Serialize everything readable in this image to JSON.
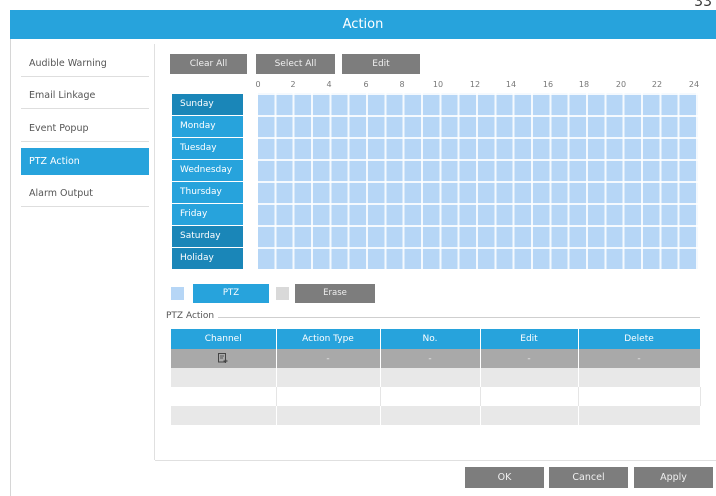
{
  "window": {
    "title": "Action",
    "top_mark": "33"
  },
  "sidebar": {
    "items": [
      {
        "label": "Audible Warning",
        "active": false
      },
      {
        "label": "Email Linkage",
        "active": false
      },
      {
        "label": "Event Popup",
        "active": false
      },
      {
        "label": "PTZ Action",
        "active": true
      },
      {
        "label": "Alarm Output",
        "active": false
      }
    ]
  },
  "toolbar": {
    "clear_all": "Clear All",
    "select_all": "Select All",
    "edit": "Edit"
  },
  "schedule": {
    "hours": [
      "0",
      "2",
      "4",
      "6",
      "8",
      "10",
      "12",
      "14",
      "16",
      "18",
      "20",
      "22",
      "24"
    ],
    "days": [
      "Sunday",
      "Monday",
      "Tuesday",
      "Wednesday",
      "Thursday",
      "Friday",
      "Saturday",
      "Holiday"
    ],
    "fill_color": "#b6d6f6",
    "all_selected": true
  },
  "legend": {
    "ptz_label": "PTZ",
    "erase_label": "Erase"
  },
  "ptz_section": {
    "label": "PTZ Action",
    "columns": [
      "Channel",
      "Action Type",
      "No.",
      "Edit",
      "Delete"
    ],
    "rows": [
      {
        "channel": "",
        "action_type": "-",
        "no": "-",
        "edit": "-",
        "delete": "-",
        "selected": true
      },
      {
        "channel": "",
        "action_type": "",
        "no": "",
        "edit": "",
        "delete": ""
      },
      {
        "channel": "",
        "action_type": "",
        "no": "",
        "edit": "",
        "delete": ""
      },
      {
        "channel": "",
        "action_type": "",
        "no": "",
        "edit": "",
        "delete": ""
      },
      {
        "channel": "",
        "action_type": "",
        "no": "",
        "edit": "",
        "delete": ""
      }
    ]
  },
  "footer": {
    "ok": "OK",
    "cancel": "Cancel",
    "apply": "Apply"
  },
  "colors": {
    "accent": "#27a3dc",
    "accent_dark": "#1a86b8",
    "button_gray": "#7d7d7d"
  },
  "icons": {
    "add_channel": "add-entry-icon"
  }
}
